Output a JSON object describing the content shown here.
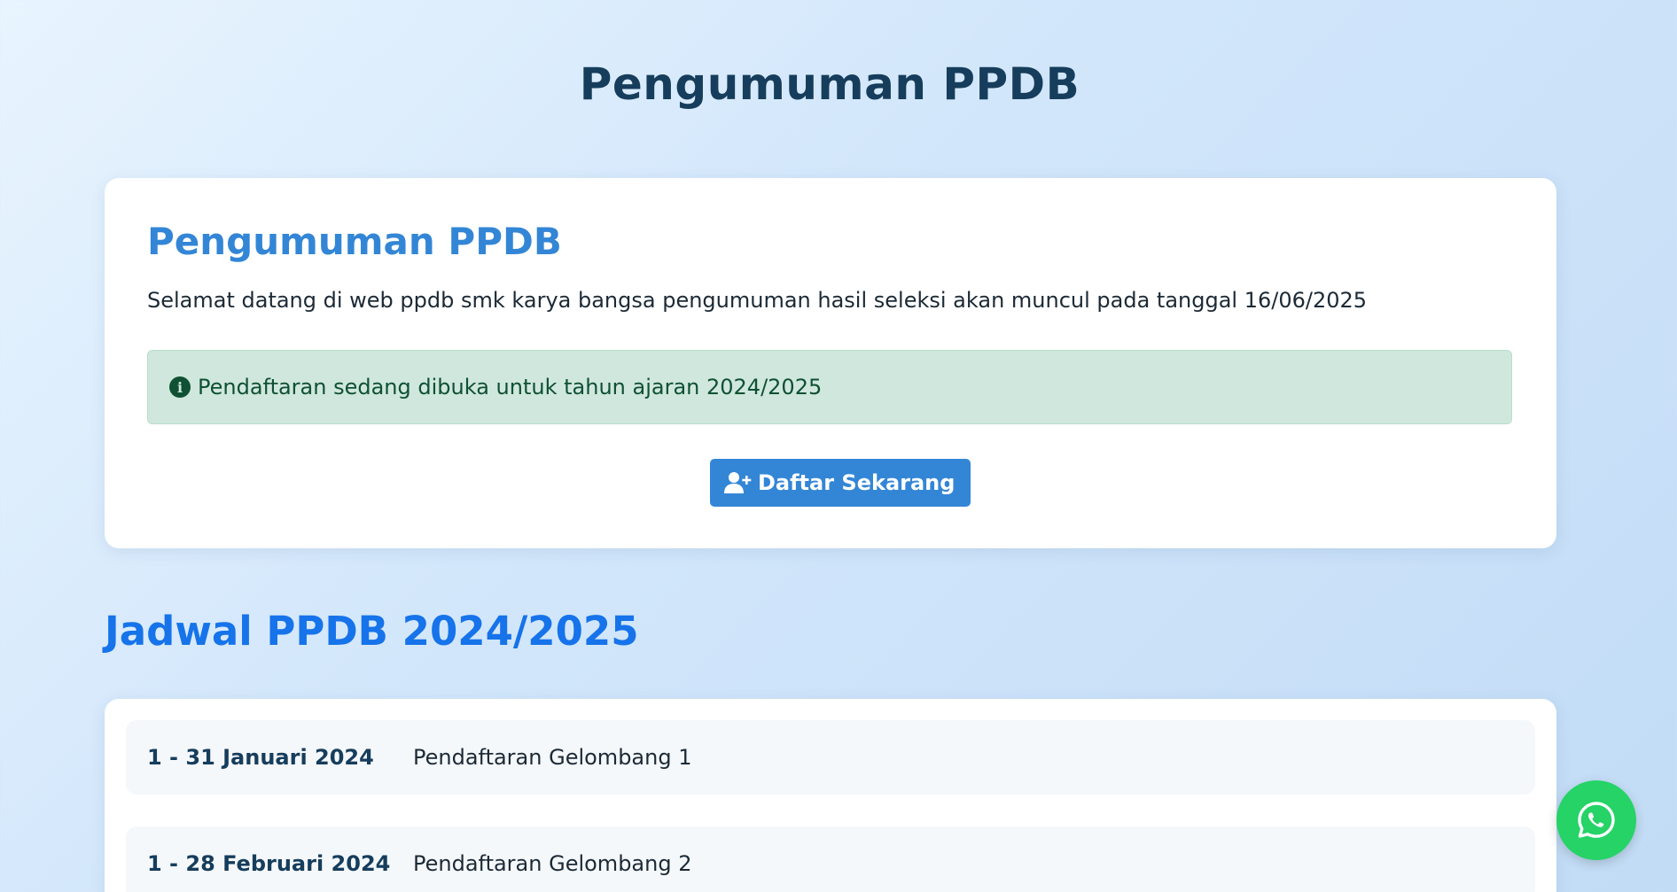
{
  "page": {
    "title": "Pengumuman PPDB"
  },
  "announcement": {
    "title": "Pengumuman PPDB",
    "description": "Selamat datang di web ppdb smk karya bangsa pengumuman hasil seleksi akan muncul pada tanggal 16/06/2025",
    "alert_text": "Pendaftaran sedang dibuka untuk tahun ajaran 2024/2025",
    "alert_icon": "info-circle-icon",
    "register_button": {
      "label": "Daftar Sekarang",
      "icon": "user-plus-icon"
    }
  },
  "schedule": {
    "title": "Jadwal PPDB 2024/2025",
    "items": [
      {
        "date": "1 - 31 Januari 2024",
        "event": "Pendaftaran Gelombang 1"
      },
      {
        "date": "1 - 28 Februari 2024",
        "event": "Pendaftaran Gelombang 2"
      }
    ]
  },
  "floating": {
    "whatsapp_icon": "whatsapp-icon"
  },
  "colors": {
    "accent": "#3386d6",
    "heading_dark": "#163d5c",
    "section_blue": "#1673ea",
    "alert_bg": "#d0e7de",
    "alert_text": "#0f5132",
    "whatsapp": "#25d366"
  }
}
